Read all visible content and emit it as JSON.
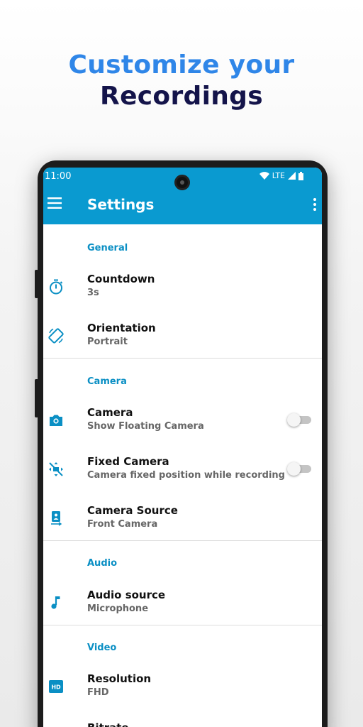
{
  "headline": {
    "line1": "Customize your",
    "line2": "Recordings"
  },
  "status_bar": {
    "time": "11:00",
    "network": "LTE"
  },
  "toolbar": {
    "title": "Settings",
    "menu_icon": "hamburger-icon",
    "more_icon": "more-vert-icon"
  },
  "colors": {
    "accent": "#0a9ad0",
    "headline_blue": "#2f86e8",
    "headline_dark": "#14144a"
  },
  "sections": {
    "general": {
      "title": "General",
      "countdown": {
        "title": "Countdown",
        "value": "3s",
        "icon": "timer-icon"
      },
      "orientation": {
        "title": "Orientation",
        "value": "Portrait",
        "icon": "screen-rotation-icon"
      }
    },
    "camera": {
      "title": "Camera",
      "camera": {
        "title": "Camera",
        "value": "Show Floating Camera",
        "icon": "camera-icon",
        "enabled": false
      },
      "fixed_camera": {
        "title": "Fixed Camera",
        "value": "Camera fixed position while recording",
        "icon": "fixed-camera-icon",
        "enabled": false
      },
      "camera_source": {
        "title": "Camera Source",
        "value": "Front Camera",
        "icon": "camera-front-icon"
      }
    },
    "audio": {
      "title": "Audio",
      "audio_source": {
        "title": "Audio source",
        "value": "Microphone",
        "icon": "music-note-icon"
      }
    },
    "video": {
      "title": "Video",
      "resolution": {
        "title": "Resolution",
        "value": "FHD",
        "icon": "hd-icon"
      },
      "bitrate": {
        "title": "Bitrate"
      }
    }
  }
}
